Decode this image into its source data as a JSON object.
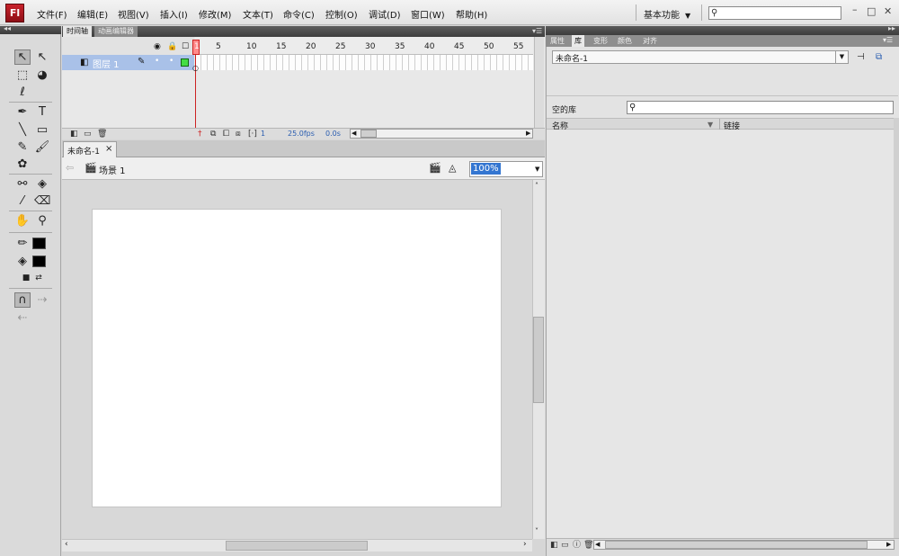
{
  "app": {
    "logo": "Fl"
  },
  "menu": {
    "items": [
      "文件(F)",
      "编辑(E)",
      "视图(V)",
      "插入(I)",
      "修改(M)",
      "文本(T)",
      "命令(C)",
      "控制(O)",
      "调试(D)",
      "窗口(W)",
      "帮助(H)"
    ]
  },
  "workspace": {
    "label": "基本功能"
  },
  "timeline": {
    "tabs": [
      "时间轴",
      "动画编辑器"
    ],
    "ruler": [
      "1",
      "5",
      "10",
      "15",
      "20",
      "25",
      "30",
      "35",
      "40",
      "45",
      "50",
      "55"
    ],
    "layer_name": "图层 1",
    "current_frame": "1",
    "frame_rate": "25.0fps",
    "elapsed": "0.0s"
  },
  "document": {
    "tab_label": "未命名-1",
    "close": "×",
    "scene": "场景 1",
    "zoom": "100%",
    "stage_color": "#ffffff"
  },
  "panels": {
    "tabs": [
      "属性",
      "库",
      "变形",
      "颜色",
      "对齐"
    ],
    "active_tab": "库",
    "library_doc": "未命名-1",
    "library_status": "空的库",
    "columns": [
      "名称",
      "链接"
    ]
  },
  "colors": {
    "accent": "#3476d1",
    "playhead": "#cc2222",
    "layer_selected": "#a9c1e8",
    "logo": "#b51c24"
  }
}
